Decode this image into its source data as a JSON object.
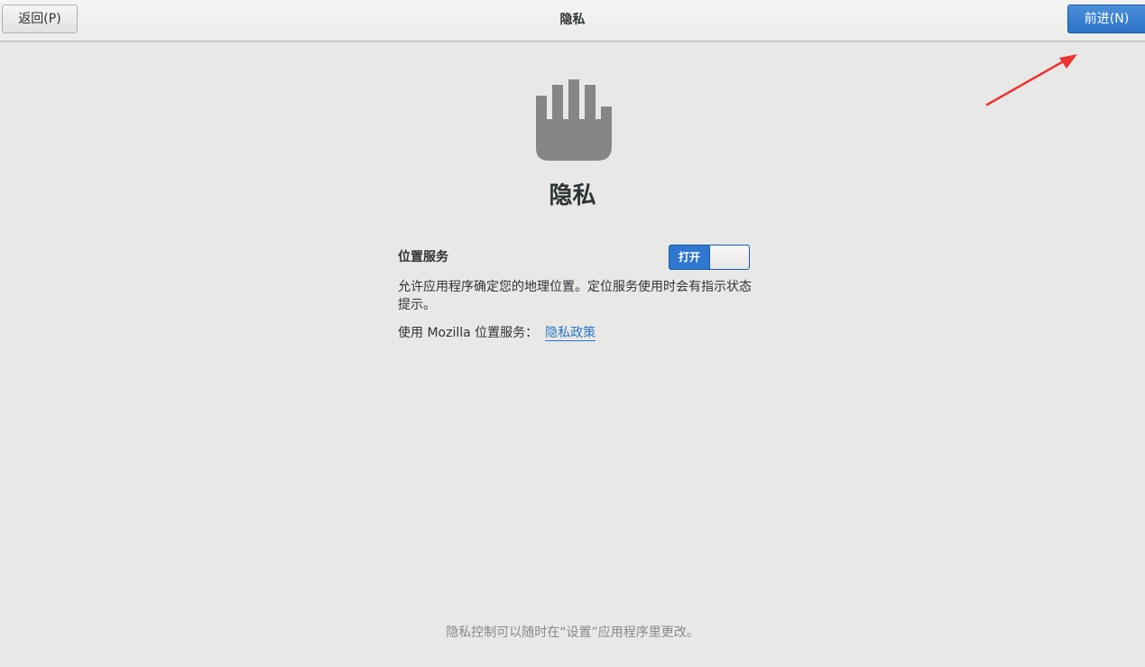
{
  "header": {
    "title": "隐私",
    "back_label": "返回(P)",
    "next_label": "前进(N)"
  },
  "page": {
    "title": "隐私",
    "icon": "hand-stop-icon"
  },
  "location": {
    "label": "位置服务",
    "switch_label": "打开",
    "switch_state": "on",
    "description": "允许应用程序确定您的地理位置。定位服务使用时会有指示状态提示。",
    "mozilla_text": "使用 Mozilla 位置服务：",
    "policy_link": "隐私政策"
  },
  "footer": {
    "text": "隐私控制可以随时在“设置”应用程序里更改。"
  },
  "colors": {
    "accent": "#3584e4",
    "background": "#e8e8e7",
    "annotation_arrow": "#ee3333",
    "icon_gray": "#858787"
  }
}
